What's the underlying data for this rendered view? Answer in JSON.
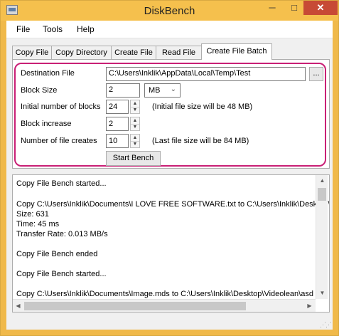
{
  "window": {
    "title": "DiskBench",
    "close_glyph": "✕",
    "minimize_glyph": "─",
    "maximize_glyph": "□",
    "icon": "app-window-icon"
  },
  "menu": [
    "File",
    "Tools",
    "Help"
  ],
  "tabs": [
    {
      "label": "Copy File"
    },
    {
      "label": "Copy Directory"
    },
    {
      "label": "Create File"
    },
    {
      "label": "Read File"
    },
    {
      "label": "Create File Batch",
      "active": true
    }
  ],
  "form": {
    "destination_label": "Destination File",
    "destination_value": "C:\\Users\\Inklik\\AppData\\Local\\Temp\\Test",
    "browse_label": "...",
    "block_size_label": "Block Size",
    "block_size_value": "2",
    "block_unit": "MB",
    "initial_blocks_label": "Initial number of blocks",
    "initial_blocks_value": "24",
    "initial_size_note": "(Initial file size will be 48 MB)",
    "block_increase_label": "Block increase",
    "block_increase_value": "2",
    "file_creates_label": "Number of file creates",
    "file_creates_value": "10",
    "last_size_note": "(Last file size will be 84 MB)",
    "start_button": "Start Bench"
  },
  "log": [
    "Copy File Bench started...",
    "",
    "Copy C:\\Users\\Inklik\\Documents\\I LOVE FREE SOFTWARE.txt to C:\\Users\\Inklik\\Desktop\\",
    "  Size: 631",
    "  Time: 45 ms",
    "  Transfer Rate: 0.013 MB/s",
    "",
    "Copy File Bench ended",
    "",
    "Copy File Bench started...",
    "",
    "Copy C:\\Users\\Inklik\\Documents\\Image.mds to C:\\Users\\Inklik\\Desktop\\Videolean\\asd"
  ],
  "accent_color": "#c91f75",
  "titlebar_color": "#f5c04d"
}
